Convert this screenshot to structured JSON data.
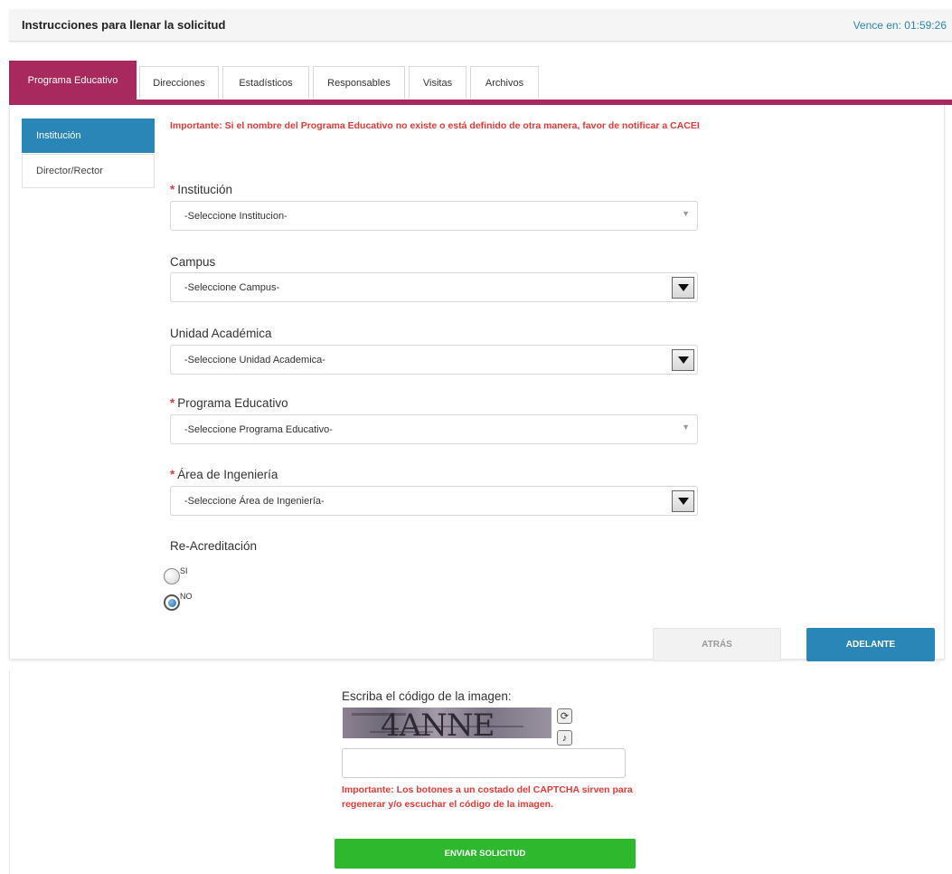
{
  "header": {
    "title": "Instrucciones para llenar la solicitud",
    "timer": "Vence en: 01:59:26"
  },
  "tabs": [
    {
      "label": "Programa Educativo",
      "active": true
    },
    {
      "label": "Direcciones",
      "active": false
    },
    {
      "label": "Estadísticos",
      "active": false
    },
    {
      "label": "Responsables",
      "active": false
    },
    {
      "label": "Visitas",
      "active": false
    },
    {
      "label": "Archivos",
      "active": false
    }
  ],
  "sidebar": {
    "items": [
      {
        "label": "Institución",
        "active": true
      },
      {
        "label": "Director/Rector",
        "active": false
      }
    ]
  },
  "form": {
    "warning": "Importante: Si el nombre del Programa Educativo no existe o está definido de otra manera, favor de notificar a CACEI",
    "fields": [
      {
        "label": "Institución",
        "required": true,
        "value": "-Seleccione Institucion-"
      },
      {
        "label": "Campus",
        "required": false,
        "value": "-Seleccione Campus-"
      },
      {
        "label": "Unidad Académica",
        "required": false,
        "value": "-Seleccione Unidad Academica-"
      },
      {
        "label": "Programa Educativo",
        "required": true,
        "value": "-Seleccione Programa Educativo-"
      },
      {
        "label": "Área de Ingeniería",
        "required": true,
        "value": "-Seleccione Área de Ingeniería-"
      }
    ],
    "reacreditacion": {
      "label": "Re-Acreditación",
      "options": [
        {
          "label": "SI",
          "checked": false
        },
        {
          "label": "NO",
          "checked": true
        }
      ]
    },
    "back_label": "ATRÁS",
    "next_label": "ADELANTE"
  },
  "captcha": {
    "label": "Escriba el código de la imagen:",
    "image_text": "4ANNE",
    "warning": "Importante: Los botones a un costado del CAPTCHA sirven para regenerar y/o escuchar el código de la imagen.",
    "submit_label": "ENVIAR SOLICITUD",
    "input_value": ""
  },
  "colors": {
    "accent": "#a8295d",
    "primary": "#2a86b6",
    "warning": "#e53935",
    "success": "#2eb82e"
  }
}
